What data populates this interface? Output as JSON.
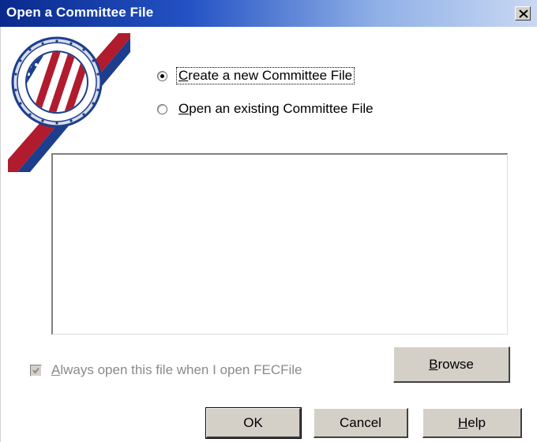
{
  "window": {
    "title": "Open a Committee File",
    "close_icon": "close-icon"
  },
  "logo": {
    "name": "fec-seal-logo",
    "text": "FEDERAL ELECTION COMMISSION · UNITED STATES OF AMERICA"
  },
  "options": {
    "create_new": {
      "label": "Create a new Committee File",
      "selected": true
    },
    "open_existing": {
      "label": "Open an existing Committee File",
      "selected": false
    }
  },
  "file_list": {
    "items": []
  },
  "checkbox": {
    "label": "Always open this file when I open FECFile",
    "checked": true,
    "enabled": false
  },
  "buttons": {
    "browse": "Browse",
    "ok": "OK",
    "cancel": "Cancel",
    "help": "Help"
  },
  "colors": {
    "title_gradient_start": "#0a2a8c",
    "title_gradient_end": "#c9d8f3",
    "button_face": "#d4d0c8",
    "disabled_text": "#8a8a8a",
    "seal_red": "#b01c2e",
    "seal_blue": "#1c3e8c"
  }
}
